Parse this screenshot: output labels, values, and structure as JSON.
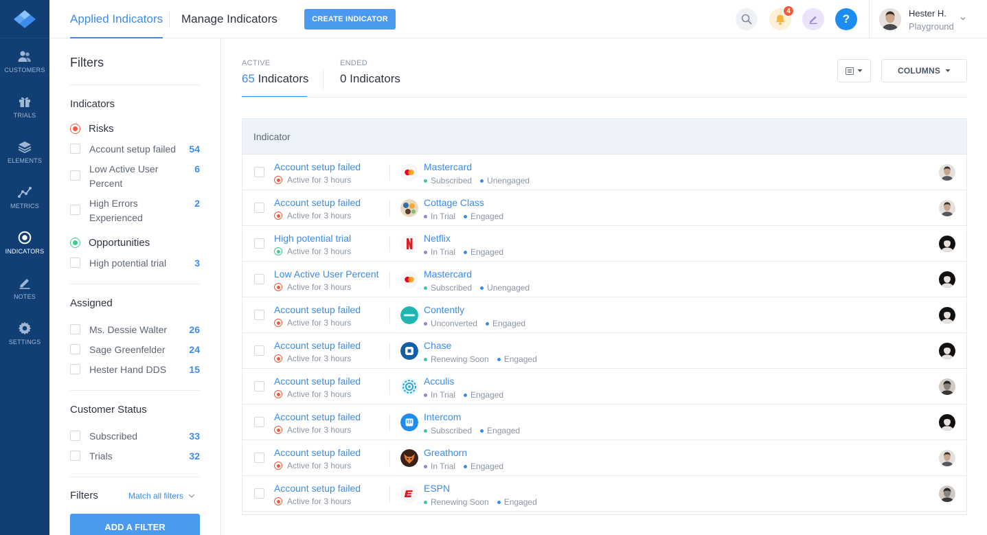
{
  "nav": {
    "items": [
      {
        "label": "CUSTOMERS",
        "icon": "customers-icon"
      },
      {
        "label": "TRIALS",
        "icon": "gift-icon"
      },
      {
        "label": "ELEMENTS",
        "icon": "layers-icon"
      },
      {
        "label": "METRICS",
        "icon": "metrics-icon"
      },
      {
        "label": "INDICATORS",
        "icon": "target-icon",
        "active": true
      },
      {
        "label": "NOTES",
        "icon": "pencil-icon"
      },
      {
        "label": "SETTINGS",
        "icon": "gear-icon"
      }
    ]
  },
  "topbar": {
    "tabs": [
      {
        "label": "Applied Indicators",
        "active": true
      },
      {
        "label": "Manage Indicators"
      }
    ],
    "create_button": "CREATE INDICATOR",
    "notification_count": "4",
    "help_label": "?",
    "user": {
      "name": "Hester H.",
      "workspace": "Playground"
    }
  },
  "filters": {
    "title": "Filters",
    "indicators_title": "Indicators",
    "risks_label": "Risks",
    "risk_items": [
      {
        "label": "Account setup failed",
        "count": "54"
      },
      {
        "label": "Low Active User Percent",
        "count": "6"
      },
      {
        "label": "High Errors Experienced",
        "count": "2"
      }
    ],
    "opportunities_label": "Opportunities",
    "opportunity_items": [
      {
        "label": "High potential trial",
        "count": "3"
      }
    ],
    "assigned_title": "Assigned",
    "assigned_items": [
      {
        "label": "Ms. Dessie Walter",
        "count": "26"
      },
      {
        "label": "Sage Greenfelder",
        "count": "24"
      },
      {
        "label": "Hester Hand DDS",
        "count": "15"
      }
    ],
    "status_title": "Customer Status",
    "status_items": [
      {
        "label": "Subscribed",
        "count": "33"
      },
      {
        "label": "Trials",
        "count": "32"
      }
    ],
    "filters_label": "Filters",
    "match_label": "Match all filters",
    "add_filter_button": "ADD A FILTER"
  },
  "main": {
    "active_label": "ACTIVE",
    "active_count": "65",
    "active_unit": "Indicators",
    "ended_label": "ENDED",
    "ended_value": "0 Indicators",
    "columns_button": "COLUMNS",
    "table_header": "Indicator",
    "rows": [
      {
        "indicator": "Account setup failed",
        "kind": "risk",
        "duration": "Active for 3 hours",
        "customer": "Mastercard",
        "logo": "mastercard-logo",
        "status": "Subscribed",
        "status_color": "#3dcc8e",
        "engagement": "Unengaged",
        "avatar": "light"
      },
      {
        "indicator": "Account setup failed",
        "kind": "risk",
        "duration": "Active for 3 hours",
        "customer": "Cottage Class",
        "logo": "cottage-class-logo",
        "status": "In Trial",
        "status_color": "#9b7de0",
        "engagement": "Engaged",
        "avatar": "light"
      },
      {
        "indicator": "High potential trial",
        "kind": "opp",
        "duration": "Active for 3 hours",
        "customer": "Netflix",
        "logo": "netflix-logo",
        "status": "In Trial",
        "status_color": "#9b7de0",
        "engagement": "Engaged",
        "avatar": "dark"
      },
      {
        "indicator": "Low Active User Percent",
        "kind": "risk",
        "duration": "Active for 3 hours",
        "customer": "Mastercard",
        "logo": "mastercard-logo",
        "status": "Subscribed",
        "status_color": "#3dcc8e",
        "engagement": "Unengaged",
        "avatar": "dark"
      },
      {
        "indicator": "Account setup failed",
        "kind": "risk",
        "duration": "Active for 3 hours",
        "customer": "Contently",
        "logo": "contently-logo",
        "status": "Unconverted",
        "status_color": "#9b7de0",
        "engagement": "Engaged",
        "avatar": "dark"
      },
      {
        "indicator": "Account setup failed",
        "kind": "risk",
        "duration": "Active for 3 hours",
        "customer": "Chase",
        "logo": "chase-logo",
        "status": "Renewing Soon",
        "status_color": "#3dcc8e",
        "engagement": "Engaged",
        "avatar": "dark"
      },
      {
        "indicator": "Account setup failed",
        "kind": "risk",
        "duration": "Active for 3 hours",
        "customer": "Acculis",
        "logo": "acculis-logo",
        "status": "In Trial",
        "status_color": "#9b7de0",
        "engagement": "Engaged",
        "avatar": "mid"
      },
      {
        "indicator": "Account setup failed",
        "kind": "risk",
        "duration": "Active for 3 hours",
        "customer": "Intercom",
        "logo": "intercom-logo",
        "status": "Subscribed",
        "status_color": "#3dcc8e",
        "engagement": "Engaged",
        "avatar": "dark"
      },
      {
        "indicator": "Account setup failed",
        "kind": "risk",
        "duration": "Active for 3 hours",
        "customer": "Greathorn",
        "logo": "greathorn-logo",
        "status": "In Trial",
        "status_color": "#9b7de0",
        "engagement": "Engaged",
        "avatar": "light"
      },
      {
        "indicator": "Account setup failed",
        "kind": "risk",
        "duration": "Active for 3 hours",
        "customer": "ESPN",
        "logo": "espn-logo",
        "status": "Renewing Soon",
        "status_color": "#3dcc8e",
        "engagement": "Engaged",
        "avatar": "mid"
      }
    ]
  },
  "colors": {
    "nav_bg": "#123f73",
    "accent": "#3b8bea",
    "risk": "#ef5a3c",
    "opportunity": "#3dcc8e",
    "engaged": "#3b8bea"
  }
}
